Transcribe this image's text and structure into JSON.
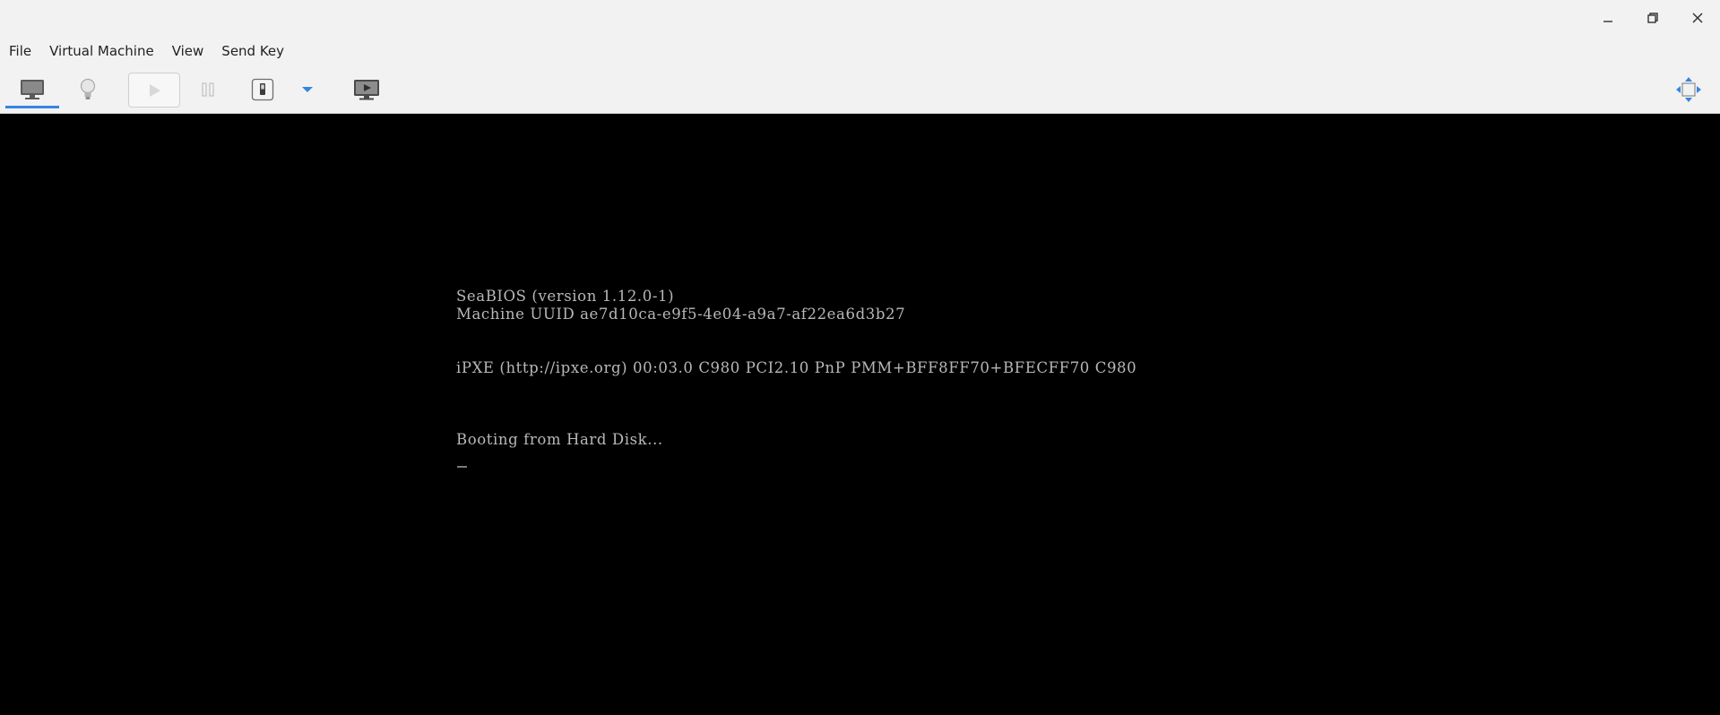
{
  "menubar": {
    "items": [
      {
        "label": "File"
      },
      {
        "label": "Virtual Machine"
      },
      {
        "label": "View"
      },
      {
        "label": "Send Key"
      }
    ]
  },
  "toolbar": {
    "buttons": [
      {
        "icon": "monitor-icon",
        "state": "active"
      },
      {
        "icon": "lightbulb-icon",
        "state": "normal"
      },
      {
        "icon": "play-icon",
        "state": "disabled"
      },
      {
        "icon": "pause-icon",
        "state": "disabled"
      },
      {
        "icon": "power-icon",
        "state": "normal"
      },
      {
        "icon": "chevron-down-icon",
        "state": "normal"
      },
      {
        "icon": "screenshot-icon",
        "state": "normal"
      },
      {
        "icon": "fullscreen-icon",
        "state": "normal"
      }
    ]
  },
  "window_controls": [
    "minimize-icon",
    "restore-icon",
    "close-icon"
  ],
  "console": {
    "lines": [
      "SeaBIOS (version 1.12.0-1)",
      "Machine UUID ae7d10ca-e9f5-4e04-a9a7-af22ea6d3b27",
      "iPXE (http://ipxe.org) 00:03.0 C980 PCI2.10 PnP PMM+BFF8FF70+BFECFF70 C980",
      "Booting from Hard Disk..."
    ]
  },
  "colors": {
    "chrome_bg": "#f2f2f2",
    "accent": "#3584e4",
    "console_bg": "#000000",
    "console_text": "#b8b8b8"
  }
}
